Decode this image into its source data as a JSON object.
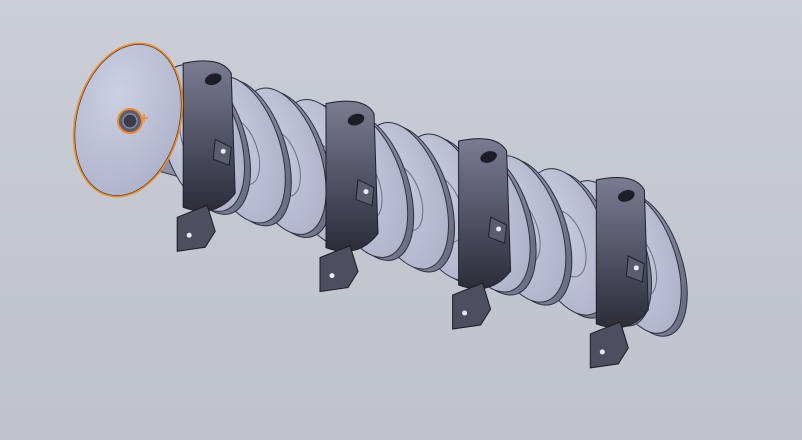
{
  "viewport": {
    "background_top": "#c9ced7",
    "background_bottom": "#bdc2cb"
  },
  "model": {
    "kind": "cam-shaft-assembly",
    "disk_face_color": "#c2c6dd",
    "disk_rim_color": "#8c90a8",
    "bearing_color": "#5e6074",
    "bearing_dark_color": "#2c2d38",
    "bracket_color": "#4d4f60",
    "selection_color": "#f08a24",
    "bearing_count": 4,
    "selected_face": "end-face-with-threaded-hole"
  }
}
